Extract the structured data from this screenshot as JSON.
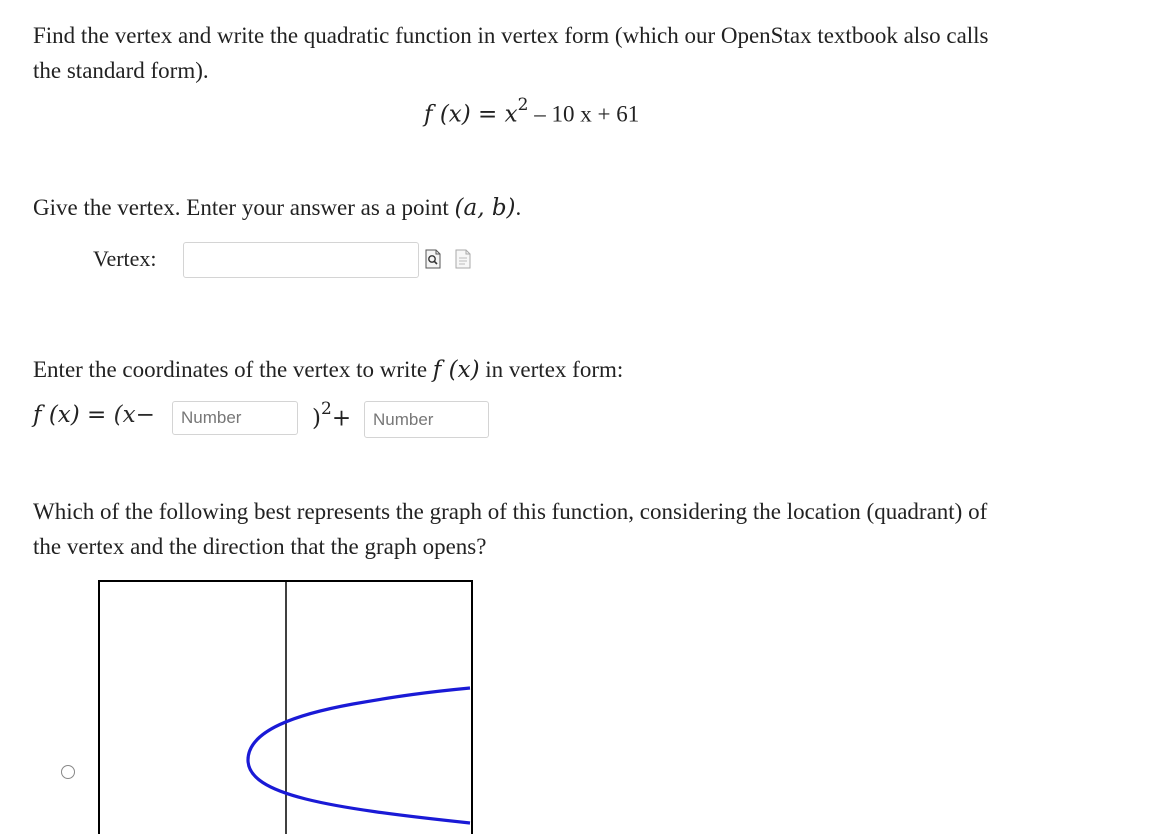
{
  "question": {
    "intro_line1": "Find the vertex and write the quadratic function in vertex form (which our OpenStax textbook also calls",
    "intro_line2": "the standard form).",
    "function_lhs": "f (x)",
    "function_eq": " = ",
    "function_x": "x",
    "function_exp": "2",
    "function_rest": " – 10 x  +  61"
  },
  "part1": {
    "prompt_text": "Give the vertex. Enter your answer as a point ",
    "prompt_math": "(a, b)",
    "prompt_end": ".",
    "vertex_label": "Vertex:",
    "vertex_value": ""
  },
  "part2": {
    "prompt_text": "Enter the coordinates of the vertex to write ",
    "prompt_math": "f (x)",
    "prompt_end": " in vertex form:",
    "lhs": "f (x)",
    "eq": " = ",
    "open": "(x−",
    "close": ")",
    "exp": "2",
    "plus": "+",
    "input_h_placeholder": "Number",
    "input_k_placeholder": "Number"
  },
  "part3": {
    "prompt_line1": "Which of the following best represents the graph of this function, considering the location (quadrant) of",
    "prompt_line2": "the vertex and the direction that the graph opens?"
  },
  "colors": {
    "curve": "#1a1ad6",
    "axis": "#000000",
    "input_border": "#d4d4d4"
  },
  "icons": {
    "preview": "preview-icon",
    "entry_help": "entry-help-icon"
  }
}
